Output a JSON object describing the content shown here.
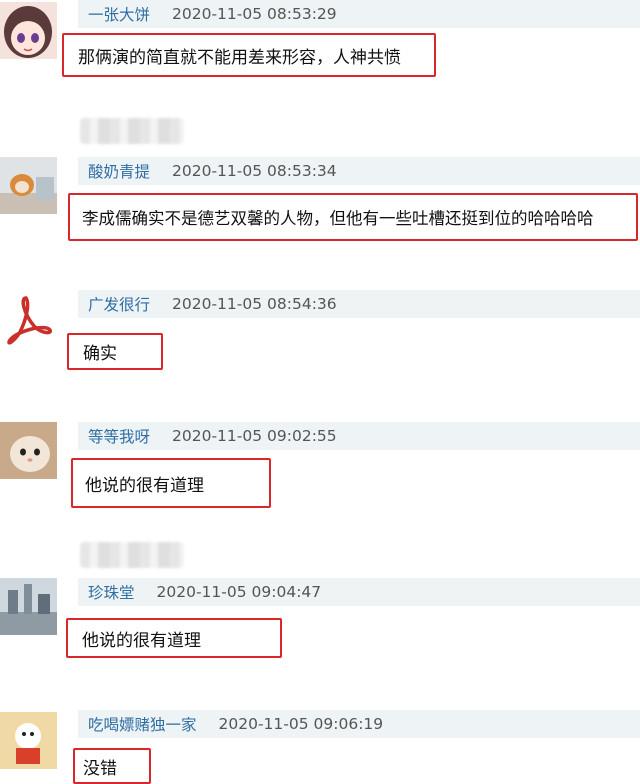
{
  "comments": [
    {
      "user": "一张大饼",
      "time": "2020-11-05 08:53:29",
      "text": "那俩演的简直就不能用差来形容，人神共愤",
      "avatar": "anime-girl-avatar"
    },
    {
      "user": "酸奶青提",
      "time": "2020-11-05 08:53:34",
      "text": "李成儒确实不是德艺双馨的人物，但他有一些吐槽还挺到位的哈哈哈哈",
      "avatar": "cat-avatar"
    },
    {
      "user": "广发很行",
      "time": "2020-11-05 08:54:36",
      "text": "确实",
      "avatar": "pdf-logo-avatar"
    },
    {
      "user": "等等我呀",
      "time": "2020-11-05 09:02:55",
      "text": "他说的很有道理",
      "avatar": "kitten-avatar"
    },
    {
      "user": "珍珠堂",
      "time": "2020-11-05 09:04:47",
      "text": "他说的很有道理",
      "avatar": "city-photo-avatar"
    },
    {
      "user": "吃喝嫖赌独一家",
      "time": "2020-11-05 09:06:19",
      "text": "没错",
      "avatar": "cartoon-avatar"
    }
  ],
  "colors": {
    "highlight_border": "#d8282b",
    "username": "#2f6ea3",
    "meta_bg": "#eef3f5"
  }
}
